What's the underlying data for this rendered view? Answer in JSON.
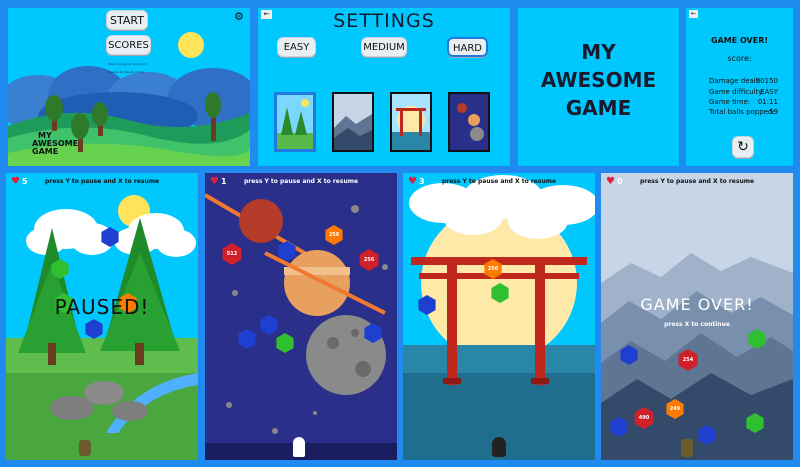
{
  "menu": {
    "start_label": "START",
    "scores_label": "SCORES",
    "title_lines": [
      "MY",
      "AWESOME",
      "GAME"
    ],
    "credits_line_1": "Music by Rendy Soundbot",
    "credits_line_2": "Sounds by Nikolai Chain"
  },
  "settings": {
    "title": "SETTINGS",
    "difficulties": [
      "EASY",
      "MEDIUM",
      "HARD"
    ],
    "selected_difficulty": "HARD",
    "themes": [
      "forest",
      "mountains",
      "torii",
      "space"
    ],
    "selected_theme": "forest"
  },
  "logo": {
    "lines": [
      "MY",
      "AWESOME",
      "GAME"
    ]
  },
  "gameover_panel": {
    "title": "GAME OVER!",
    "score_label": "score:",
    "stats": [
      {
        "label": "Damage dealt:",
        "value": "30150"
      },
      {
        "label": "Game difficulty:",
        "value": "EASY"
      },
      {
        "label": "Game time:",
        "value": "01:11"
      },
      {
        "label": "Total balls popped:",
        "value": "59"
      }
    ]
  },
  "games": [
    {
      "lives": "5",
      "hint": "press Y to pause and X to resume",
      "overlay": "PAUSED!",
      "theme": "forest"
    },
    {
      "lives": "1",
      "hint": "press Y to pause and X to resume",
      "overlay": "",
      "theme": "space"
    },
    {
      "lives": "3",
      "hint": "press Y to pause and X to resume",
      "overlay": "",
      "theme": "torii"
    },
    {
      "lives": "0",
      "hint": "press Y to pause and X to resume",
      "overlay": "GAME OVER!",
      "sub": "press X to continue",
      "theme": "mountains"
    }
  ],
  "balls": {
    "g2_a": "512",
    "g2_b": "256",
    "g2_c": "256",
    "g3_a": "256",
    "g4_a": "254",
    "g4_b": "490",
    "g4_c": "249"
  },
  "colors": {
    "background": "#1f8bf0",
    "sky": "#00c8ff",
    "space": "#2a2f8a",
    "selected_border": "#1f7ae0"
  }
}
